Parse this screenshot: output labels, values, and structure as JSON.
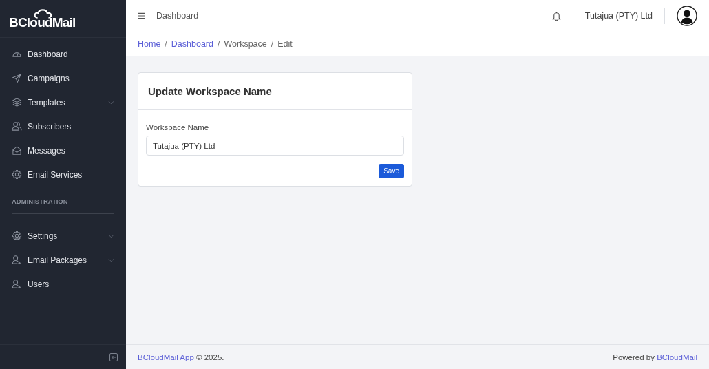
{
  "sidebar": {
    "logo": "BCloudMail",
    "items": [
      {
        "label": "Dashboard",
        "kind": "gauge",
        "has_submenu": false
      },
      {
        "label": "Campaigns",
        "kind": "send",
        "has_submenu": false
      },
      {
        "label": "Templates",
        "kind": "layers",
        "has_submenu": true
      },
      {
        "label": "Subscribers",
        "kind": "people",
        "has_submenu": false
      },
      {
        "label": "Messages",
        "kind": "envelope",
        "has_submenu": false
      },
      {
        "label": "Email Services",
        "kind": "gear",
        "has_submenu": false
      }
    ],
    "section_title": "ADMINISTRATION",
    "admin_items": [
      {
        "label": "Settings",
        "kind": "gear",
        "has_submenu": true
      },
      {
        "label": "Email Packages",
        "kind": "user-plus",
        "has_submenu": true
      },
      {
        "label": "Users",
        "kind": "user-plus",
        "has_submenu": false
      }
    ]
  },
  "topbar": {
    "title": "Dashboard",
    "account": "Tutajua (PTY) Ltd"
  },
  "breadcrumb": [
    {
      "label": "Home",
      "link": true
    },
    {
      "separator": "/",
      "label": "Dashboard",
      "link": true
    },
    {
      "separator": "/",
      "label": "Workspace",
      "link": false
    },
    {
      "separator": "/",
      "label": "Edit",
      "link": false
    }
  ],
  "card": {
    "title": "Update Workspace Name",
    "field_label": "Workspace Name",
    "field_value": "Tutajua (PTY) Ltd",
    "button": "Save"
  },
  "footer": {
    "app_link": "BCloudMail App",
    "copyright": "© 2025.",
    "powered": "Powered by",
    "powered_link": "BCloudMail"
  }
}
